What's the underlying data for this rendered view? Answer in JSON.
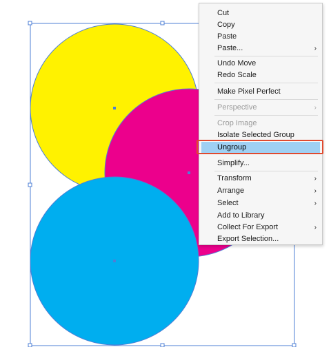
{
  "colors": {
    "yellow": "#fff200",
    "magenta": "#ec008c",
    "cyan": "#00aeef",
    "selection": "#4d7fd6",
    "highlight_box": "#e04a2f",
    "menu_highlight": "#9fd0f3"
  },
  "icons": {
    "submenu": "chevron-right-icon"
  },
  "context_menu": {
    "items": [
      {
        "label": "Cut",
        "enabled": true,
        "submenu": false
      },
      {
        "label": "Copy",
        "enabled": true,
        "submenu": false
      },
      {
        "label": "Paste",
        "enabled": true,
        "submenu": false
      },
      {
        "label": "Paste...",
        "enabled": true,
        "submenu": true
      },
      {
        "label": "Undo Move",
        "enabled": true,
        "submenu": false
      },
      {
        "label": "Redo Scale",
        "enabled": true,
        "submenu": false
      },
      {
        "label": "Make Pixel Perfect",
        "enabled": true,
        "submenu": false
      },
      {
        "label": "Perspective",
        "enabled": false,
        "submenu": true
      },
      {
        "label": "Crop Image",
        "enabled": false,
        "submenu": false
      },
      {
        "label": "Isolate Selected Group",
        "enabled": true,
        "submenu": false
      },
      {
        "label": "Ungroup",
        "enabled": true,
        "submenu": false,
        "highlighted": true
      },
      {
        "label": "Simplify...",
        "enabled": true,
        "submenu": false
      },
      {
        "label": "Transform",
        "enabled": true,
        "submenu": true
      },
      {
        "label": "Arrange",
        "enabled": true,
        "submenu": true
      },
      {
        "label": "Select",
        "enabled": true,
        "submenu": true
      },
      {
        "label": "Add to Library",
        "enabled": true,
        "submenu": false
      },
      {
        "label": "Collect For Export",
        "enabled": true,
        "submenu": true
      },
      {
        "label": "Export Selection...",
        "enabled": true,
        "submenu": false
      }
    ],
    "submenu_glyph": "›"
  }
}
